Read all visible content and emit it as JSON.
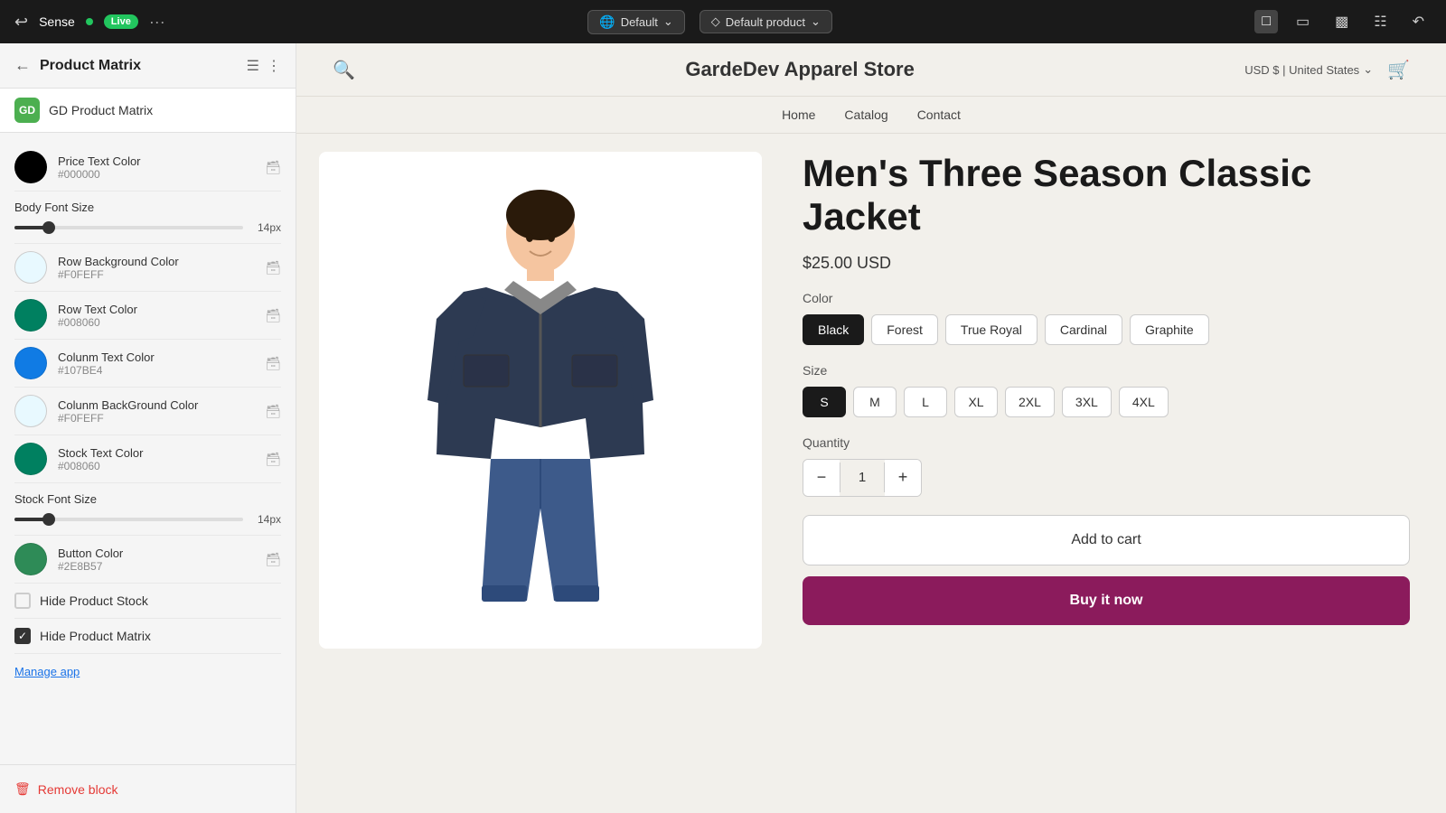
{
  "topbar": {
    "app_name": "Sense",
    "live_label": "Live",
    "default_theme": "Default",
    "default_product": "Default product",
    "dots": "···"
  },
  "sidebar": {
    "title": "Product Matrix",
    "app_icon_label": "GD",
    "app_name": "GD Product Matrix",
    "colors": [
      {
        "label": "Price Text Color",
        "hex": "#000000",
        "swatch": "#000000"
      },
      {
        "label": "Row Background Color",
        "hex": "#F0FEFF",
        "swatch": "#e8f9ff"
      },
      {
        "label": "Row Text Color",
        "hex": "#008060",
        "swatch": "#008060"
      },
      {
        "label": "Colunm Text Color",
        "hex": "#107BE4",
        "swatch": "#107BE4"
      },
      {
        "label": "Colunm BackGround Color",
        "hex": "#F0FEFF",
        "swatch": "#e8f9ff"
      },
      {
        "label": "Stock Text Color",
        "hex": "#008060",
        "swatch": "#008060"
      },
      {
        "label": "Button Color",
        "hex": "#2E8B57",
        "swatch": "#2E8B57"
      }
    ],
    "body_font_size_label": "Body Font Size",
    "body_font_size_value": "14px",
    "body_font_slider_pct": 15,
    "stock_font_size_label": "Stock Font Size",
    "stock_font_size_value": "14px",
    "stock_font_slider_pct": 15,
    "hide_stock_label": "Hide Product Stock",
    "hide_stock_checked": false,
    "hide_matrix_label": "Hide Product Matrix",
    "hide_matrix_checked": true,
    "manage_app_label": "Manage app",
    "remove_block_label": "Remove block"
  },
  "store": {
    "name": "GardeDev Apparel Store",
    "currency": "USD $ | United States",
    "nav": [
      "Home",
      "Catalog",
      "Contact"
    ],
    "product": {
      "title": "Men's Three Season Classic Jacket",
      "price": "$25.00 USD",
      "color_label": "Color",
      "colors": [
        {
          "label": "Black",
          "selected": true
        },
        {
          "label": "Forest",
          "selected": false
        },
        {
          "label": "True Royal",
          "selected": false
        },
        {
          "label": "Cardinal",
          "selected": false
        },
        {
          "label": "Graphite",
          "selected": false
        }
      ],
      "size_label": "Size",
      "sizes": [
        {
          "label": "S",
          "selected": true
        },
        {
          "label": "M",
          "selected": false
        },
        {
          "label": "L",
          "selected": false
        },
        {
          "label": "XL",
          "selected": false
        },
        {
          "label": "2XL",
          "selected": false
        },
        {
          "label": "3XL",
          "selected": false
        },
        {
          "label": "4XL",
          "selected": false
        }
      ],
      "quantity_label": "Quantity",
      "quantity_value": "1",
      "add_to_cart": "Add to cart",
      "buy_now": "Buy it now"
    }
  }
}
